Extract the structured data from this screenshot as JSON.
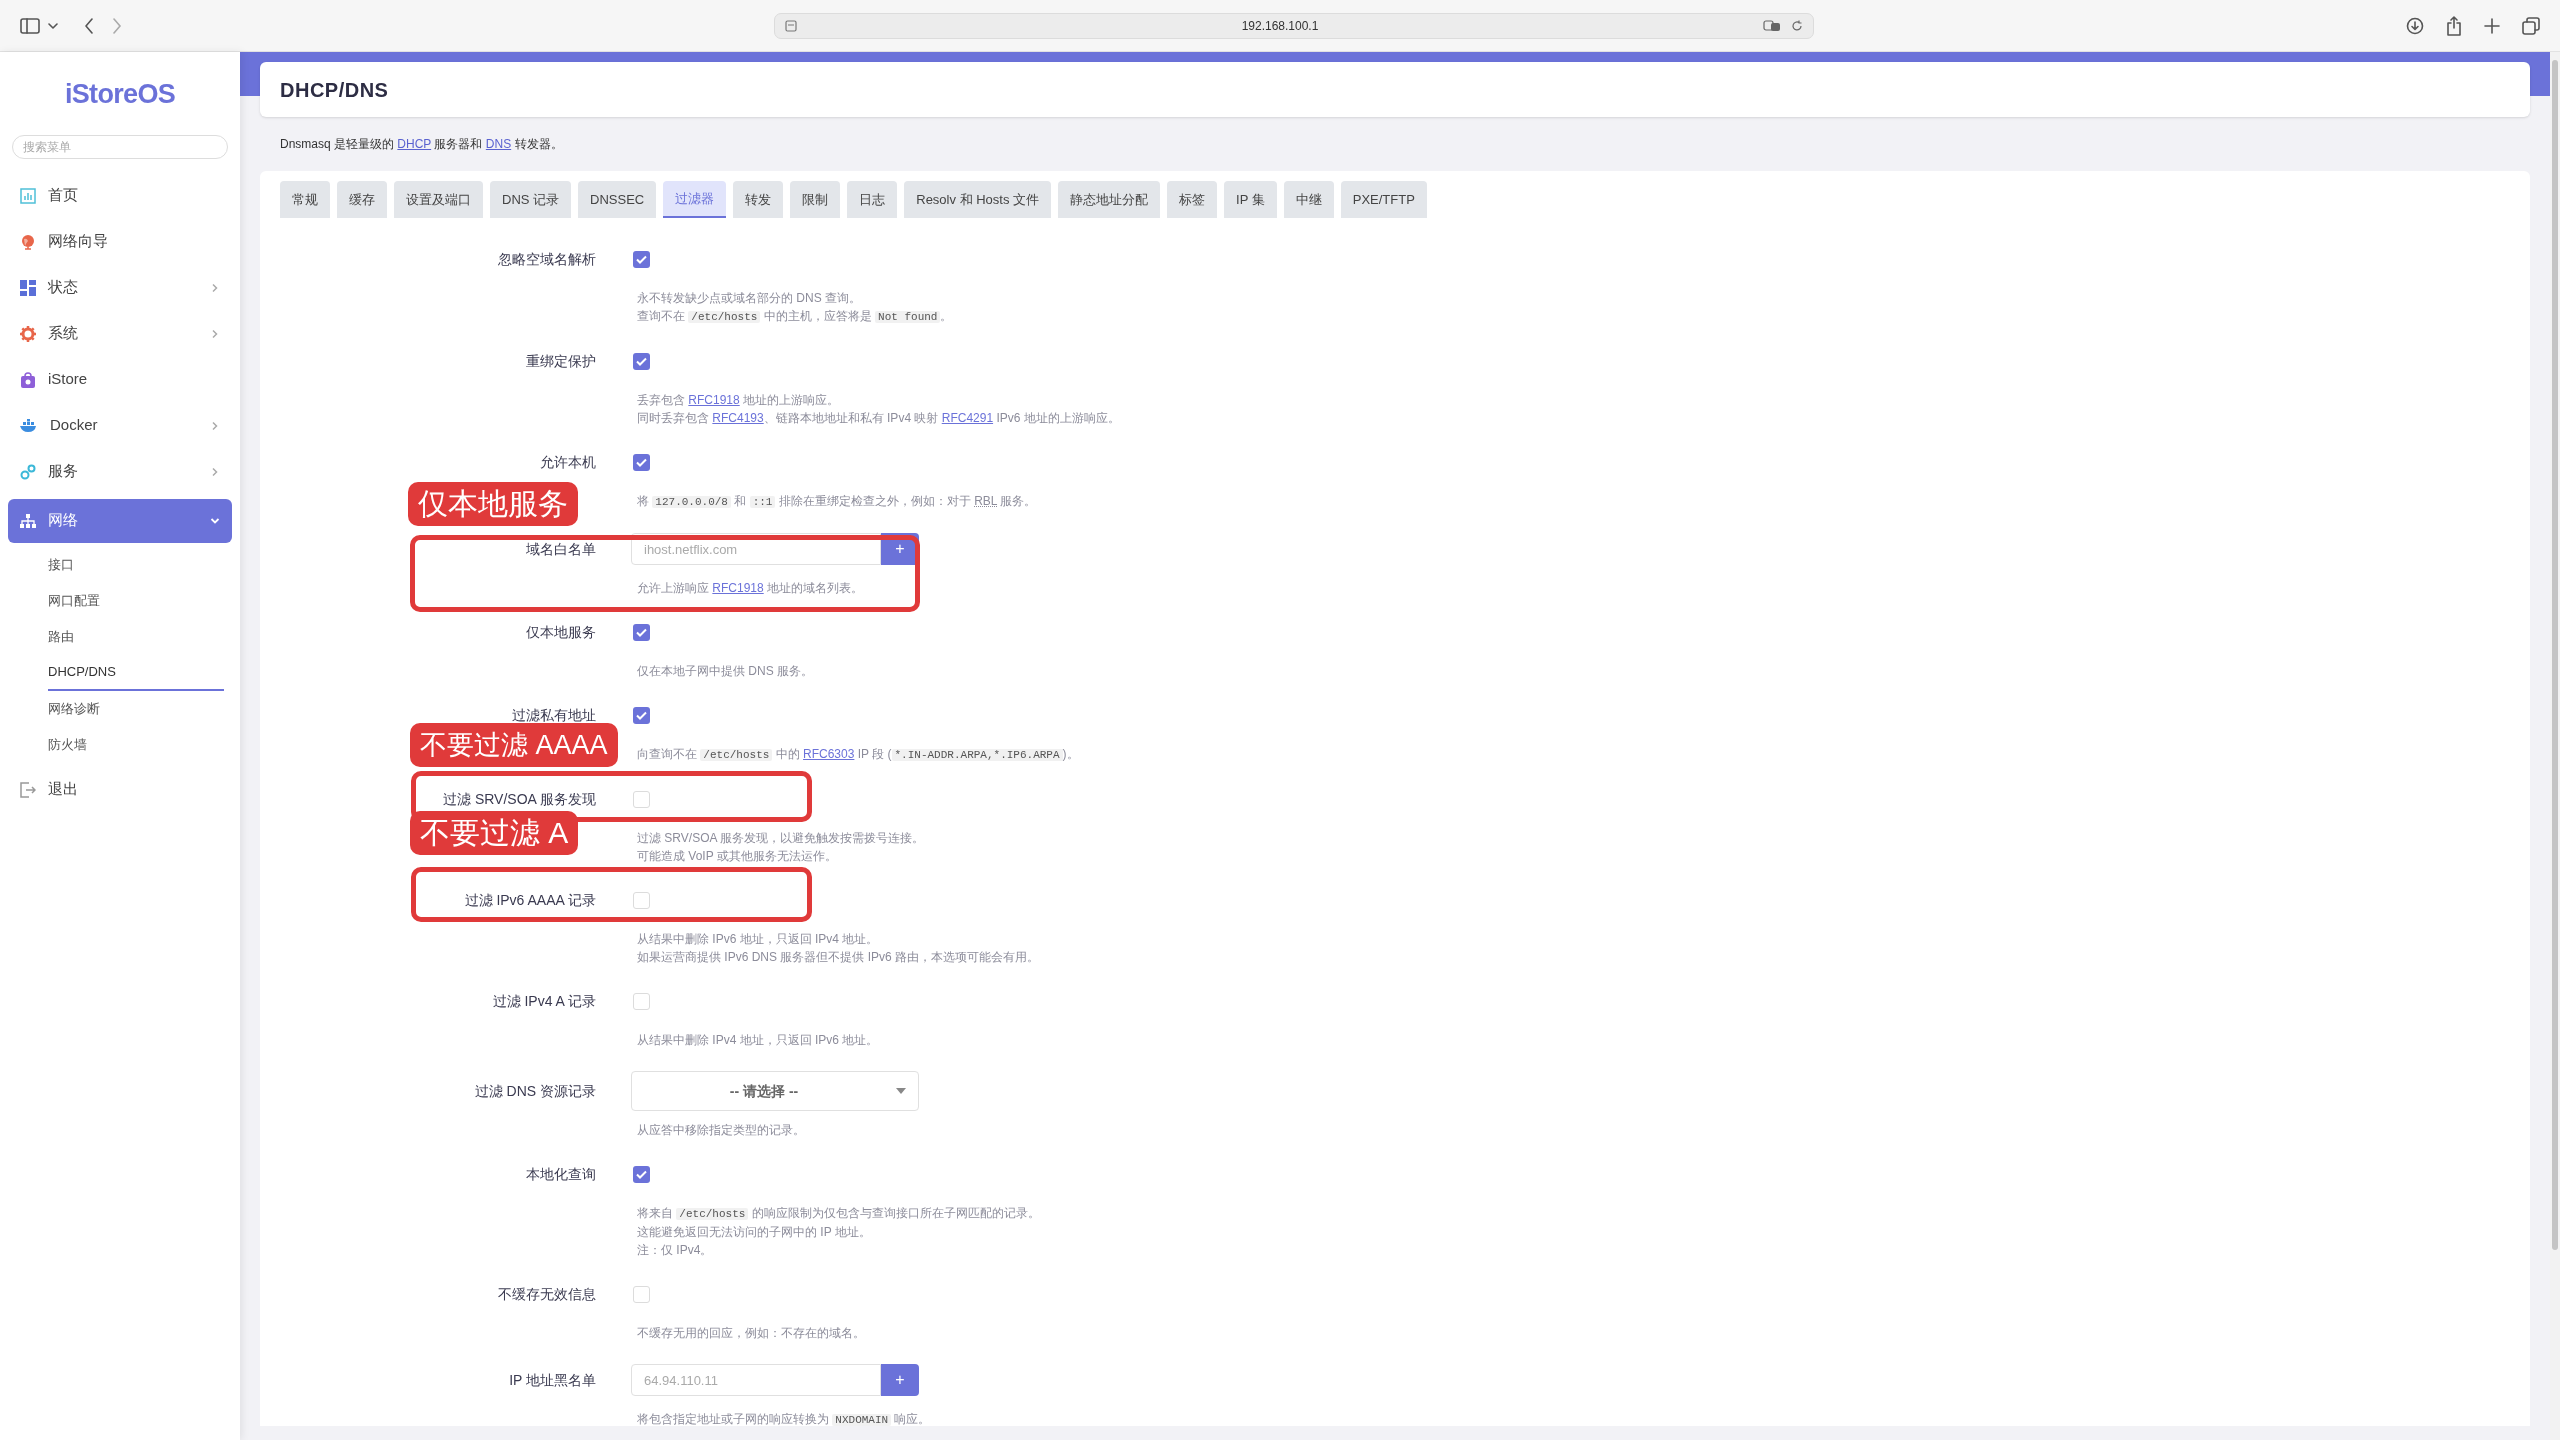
{
  "browser": {
    "url": "192.168.100.1"
  },
  "sidebar": {
    "logo": "iStoreOS",
    "search": {
      "placeholder": "搜索菜单"
    },
    "items": [
      {
        "label": "首页",
        "has_submenu": false,
        "selected": false
      },
      {
        "label": "网络向导",
        "has_submenu": false,
        "selected": false
      },
      {
        "label": "状态",
        "has_submenu": true,
        "expanded": false,
        "selected": false
      },
      {
        "label": "系统",
        "has_submenu": true,
        "expanded": false,
        "selected": false
      },
      {
        "label": "iStore",
        "has_submenu": false,
        "selected": false
      },
      {
        "label": "Docker",
        "has_submenu": true,
        "expanded": false,
        "selected": false
      },
      {
        "label": "服务",
        "has_submenu": true,
        "expanded": false,
        "selected": false
      },
      {
        "label": "网络",
        "has_submenu": true,
        "expanded": true,
        "selected": true,
        "children": [
          {
            "label": "接口",
            "selected": false
          },
          {
            "label": "网口配置",
            "selected": false
          },
          {
            "label": "路由",
            "selected": false
          },
          {
            "label": "DHCP/DNS",
            "selected": true
          },
          {
            "label": "网络诊断",
            "selected": false
          },
          {
            "label": "防火墙",
            "selected": false
          }
        ]
      },
      {
        "label": "退出",
        "has_submenu": false,
        "selected": false
      }
    ]
  },
  "page": {
    "title": "DHCP/DNS",
    "intro": [
      {
        "text": "Dnsmasq 是轻量级的 "
      },
      {
        "kind": "link",
        "text": "DHCP"
      },
      {
        "text": " 服务器和 "
      },
      {
        "kind": "link",
        "text": "DNS"
      },
      {
        "text": " 转发器。"
      }
    ],
    "tabs": [
      {
        "label": "常规",
        "selected": false
      },
      {
        "label": "缓存",
        "selected": false
      },
      {
        "label": "设置及端口",
        "selected": false
      },
      {
        "label": "DNS 记录",
        "selected": false
      },
      {
        "label": "DNSSEC",
        "selected": false
      },
      {
        "label": "过滤器",
        "selected": true
      },
      {
        "label": "转发",
        "selected": false
      },
      {
        "label": "限制",
        "selected": false
      },
      {
        "label": "日志",
        "selected": false
      },
      {
        "label": "Resolv 和 Hosts 文件",
        "selected": false
      },
      {
        "label": "静态地址分配",
        "selected": false
      },
      {
        "label": "标签",
        "selected": false
      },
      {
        "label": "IP 集",
        "selected": false
      },
      {
        "label": "中继",
        "selected": false
      },
      {
        "label": "PXE/TFTP",
        "selected": false
      }
    ],
    "fields": [
      {
        "kind": "checkbox",
        "label": "忽略空域名解析",
        "checked": true,
        "description": [
          [
            {
              "text": "永不转发缺少点或域名部分的 DNS 查询。"
            }
          ],
          [
            {
              "text": "查询不在 "
            },
            {
              "kind": "code",
              "text": "/etc/hosts"
            },
            {
              "text": " 中的主机，应答将是 "
            },
            {
              "kind": "code",
              "text": "Not found"
            },
            {
              "text": "。"
            }
          ]
        ]
      },
      {
        "kind": "checkbox",
        "label": "重绑定保护",
        "checked": true,
        "description": [
          [
            {
              "text": "丢弃包含 "
            },
            {
              "kind": "link",
              "text": "RFC1918"
            },
            {
              "text": " 地址的上游响应。"
            }
          ],
          [
            {
              "text": "同时丢弃包含 "
            },
            {
              "kind": "link",
              "text": "RFC4193"
            },
            {
              "text": "、链路本地地址和私有 IPv4 映射 "
            },
            {
              "kind": "link",
              "text": "RFC4291"
            },
            {
              "text": " IPv6 地址的上游响应。"
            }
          ]
        ]
      },
      {
        "kind": "checkbox",
        "label": "允许本机",
        "checked": true,
        "description": [
          [
            {
              "text": "将 "
            },
            {
              "kind": "code",
              "text": "127.0.0.0/8"
            },
            {
              "text": " 和 "
            },
            {
              "kind": "code",
              "text": "::1"
            },
            {
              "text": " 排除在重绑定检查之外，例如：对于 "
            },
            {
              "kind": "abbr",
              "text": "RBL"
            },
            {
              "text": " 服务。"
            }
          ]
        ]
      },
      {
        "kind": "list_input",
        "label": "域名白名单",
        "placeholder": "ihost.netflix.com",
        "button": "+",
        "description": [
          [
            {
              "text": "允许上游响应 "
            },
            {
              "kind": "link",
              "text": "RFC1918"
            },
            {
              "text": " 地址的域名列表。"
            }
          ]
        ]
      },
      {
        "kind": "checkbox",
        "label": "仅本地服务",
        "checked": true,
        "description": [
          [
            {
              "text": "仅在本地子网中提供 DNS 服务。"
            }
          ]
        ]
      },
      {
        "kind": "checkbox",
        "label": "过滤私有地址",
        "checked": true,
        "description": [
          [
            {
              "text": "向查询不在 "
            },
            {
              "kind": "code",
              "text": "/etc/hosts"
            },
            {
              "text": " 中的 "
            },
            {
              "kind": "link",
              "text": "RFC6303"
            },
            {
              "text": " IP 段 ("
            },
            {
              "kind": "code",
              "text": "*.IN-ADDR.ARPA,*.IP6.ARPA"
            },
            {
              "text": ")。"
            }
          ]
        ]
      },
      {
        "kind": "checkbox",
        "label": "过滤 SRV/SOA 服务发现",
        "checked": false,
        "description": [
          [
            {
              "text": "过滤 SRV/SOA 服务发现，以避免触发按需拨号连接。"
            }
          ],
          [
            {
              "text": "可能造成 VoIP 或其他服务无法运作。"
            }
          ]
        ]
      },
      {
        "kind": "checkbox",
        "label": "过滤 IPv6 AAAA 记录",
        "checked": false,
        "description": [
          [
            {
              "text": "从结果中删除 IPv6 地址，只返回 IPv4 地址。"
            }
          ],
          [
            {
              "text": "如果运营商提供 IPv6 DNS 服务器但不提供 IPv6 路由，本选项可能会有用。"
            }
          ]
        ]
      },
      {
        "kind": "checkbox",
        "label": "过滤 IPv4 A 记录",
        "checked": false,
        "description": [
          [
            {
              "text": "从结果中删除 IPv4 地址，只返回 IPv6 地址。"
            }
          ]
        ]
      },
      {
        "kind": "select",
        "label": "过滤 DNS 资源记录",
        "value": "-- 请选择 --",
        "description": [
          [
            {
              "text": "从应答中移除指定类型的记录。"
            }
          ]
        ]
      },
      {
        "kind": "checkbox",
        "label": "本地化查询",
        "checked": true,
        "description": [
          [
            {
              "text": "将来自 "
            },
            {
              "kind": "code",
              "text": "/etc/hosts"
            },
            {
              "text": " 的响应限制为仅包含与查询接口所在子网匹配的记录。"
            }
          ],
          [
            {
              "text": "这能避免返回无法访问的子网中的 IP 地址。"
            }
          ],
          [
            {
              "text": "注：仅 IPv4。"
            }
          ]
        ]
      },
      {
        "kind": "checkbox",
        "label": "不缓存无效信息",
        "checked": false,
        "description": [
          [
            {
              "text": "不缓存无用的回应，例如：不存在的域名。"
            }
          ]
        ]
      },
      {
        "kind": "list_input",
        "label": "IP 地址黑名单",
        "placeholder": "64.94.110.11",
        "button": "+",
        "description": [
          [
            {
              "text": "将包含指定地址或子网的响应转换为 "
            },
            {
              "kind": "code",
              "text": "NXDOMAIN"
            },
            {
              "text": " 响应。"
            }
          ]
        ]
      }
    ]
  },
  "annotations": [
    {
      "kind": "label",
      "text": "仅本地服务"
    },
    {
      "kind": "frame"
    },
    {
      "kind": "label",
      "text": "不要过滤 AAAA"
    },
    {
      "kind": "frame"
    },
    {
      "kind": "label",
      "text": "不要过滤 A"
    },
    {
      "kind": "frame"
    }
  ]
}
